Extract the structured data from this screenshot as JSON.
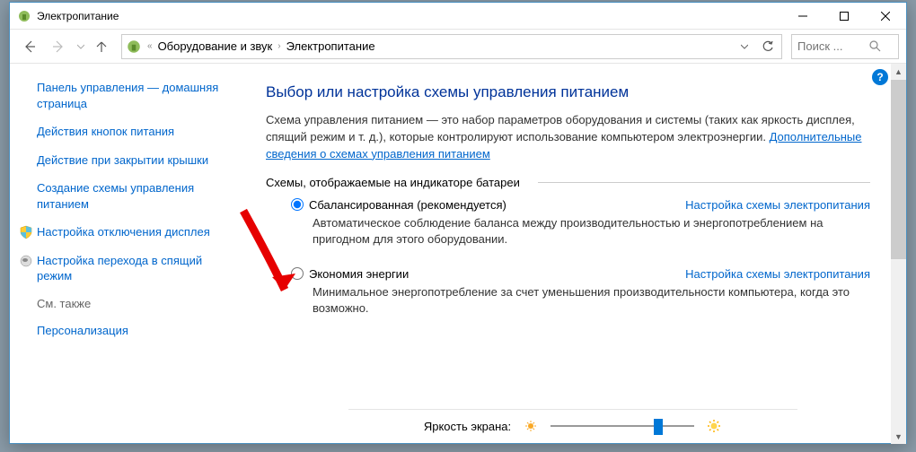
{
  "title": "Электропитание",
  "breadcrumb": {
    "part1": "Оборудование и звук",
    "part2": "Электропитание"
  },
  "search": {
    "placeholder": "Поиск ..."
  },
  "sidebar": {
    "home": "Панель управления — домашняя страница",
    "link1": "Действия кнопок питания",
    "link2": "Действие при закрытии крышки",
    "link3": "Создание схемы управления питанием",
    "link4": "Настройка отключения дисплея",
    "link5": "Настройка перехода в спящий режим",
    "seeAlsoTitle": "См. также",
    "seeAlso1": "Персонализация"
  },
  "content": {
    "heading": "Выбор или настройка схемы управления питанием",
    "desc": "Схема управления питанием — это набор параметров оборудования и системы (таких как яркость дисплея, спящий режим и т. д.), которые контролируют использование компьютером электроэнергии. ",
    "descLink": "Дополнительные сведения о схемах управления питанием",
    "groupLabel": "Схемы, отображаемые на индикаторе батареи",
    "plan1": {
      "name": "Сбалансированная (рекомендуется)",
      "desc": "Автоматическое соблюдение баланса между производительностью и энергопотреблением на пригодном для этого оборудовании.",
      "link": "Настройка схемы электропитания"
    },
    "plan2": {
      "name": "Экономия энергии",
      "desc": "Минимальное энергопотребление за счет уменьшения производительности компьютера, когда это возможно.",
      "link": "Настройка схемы электропитания"
    },
    "brightnessLabel": "Яркость экрана:"
  }
}
